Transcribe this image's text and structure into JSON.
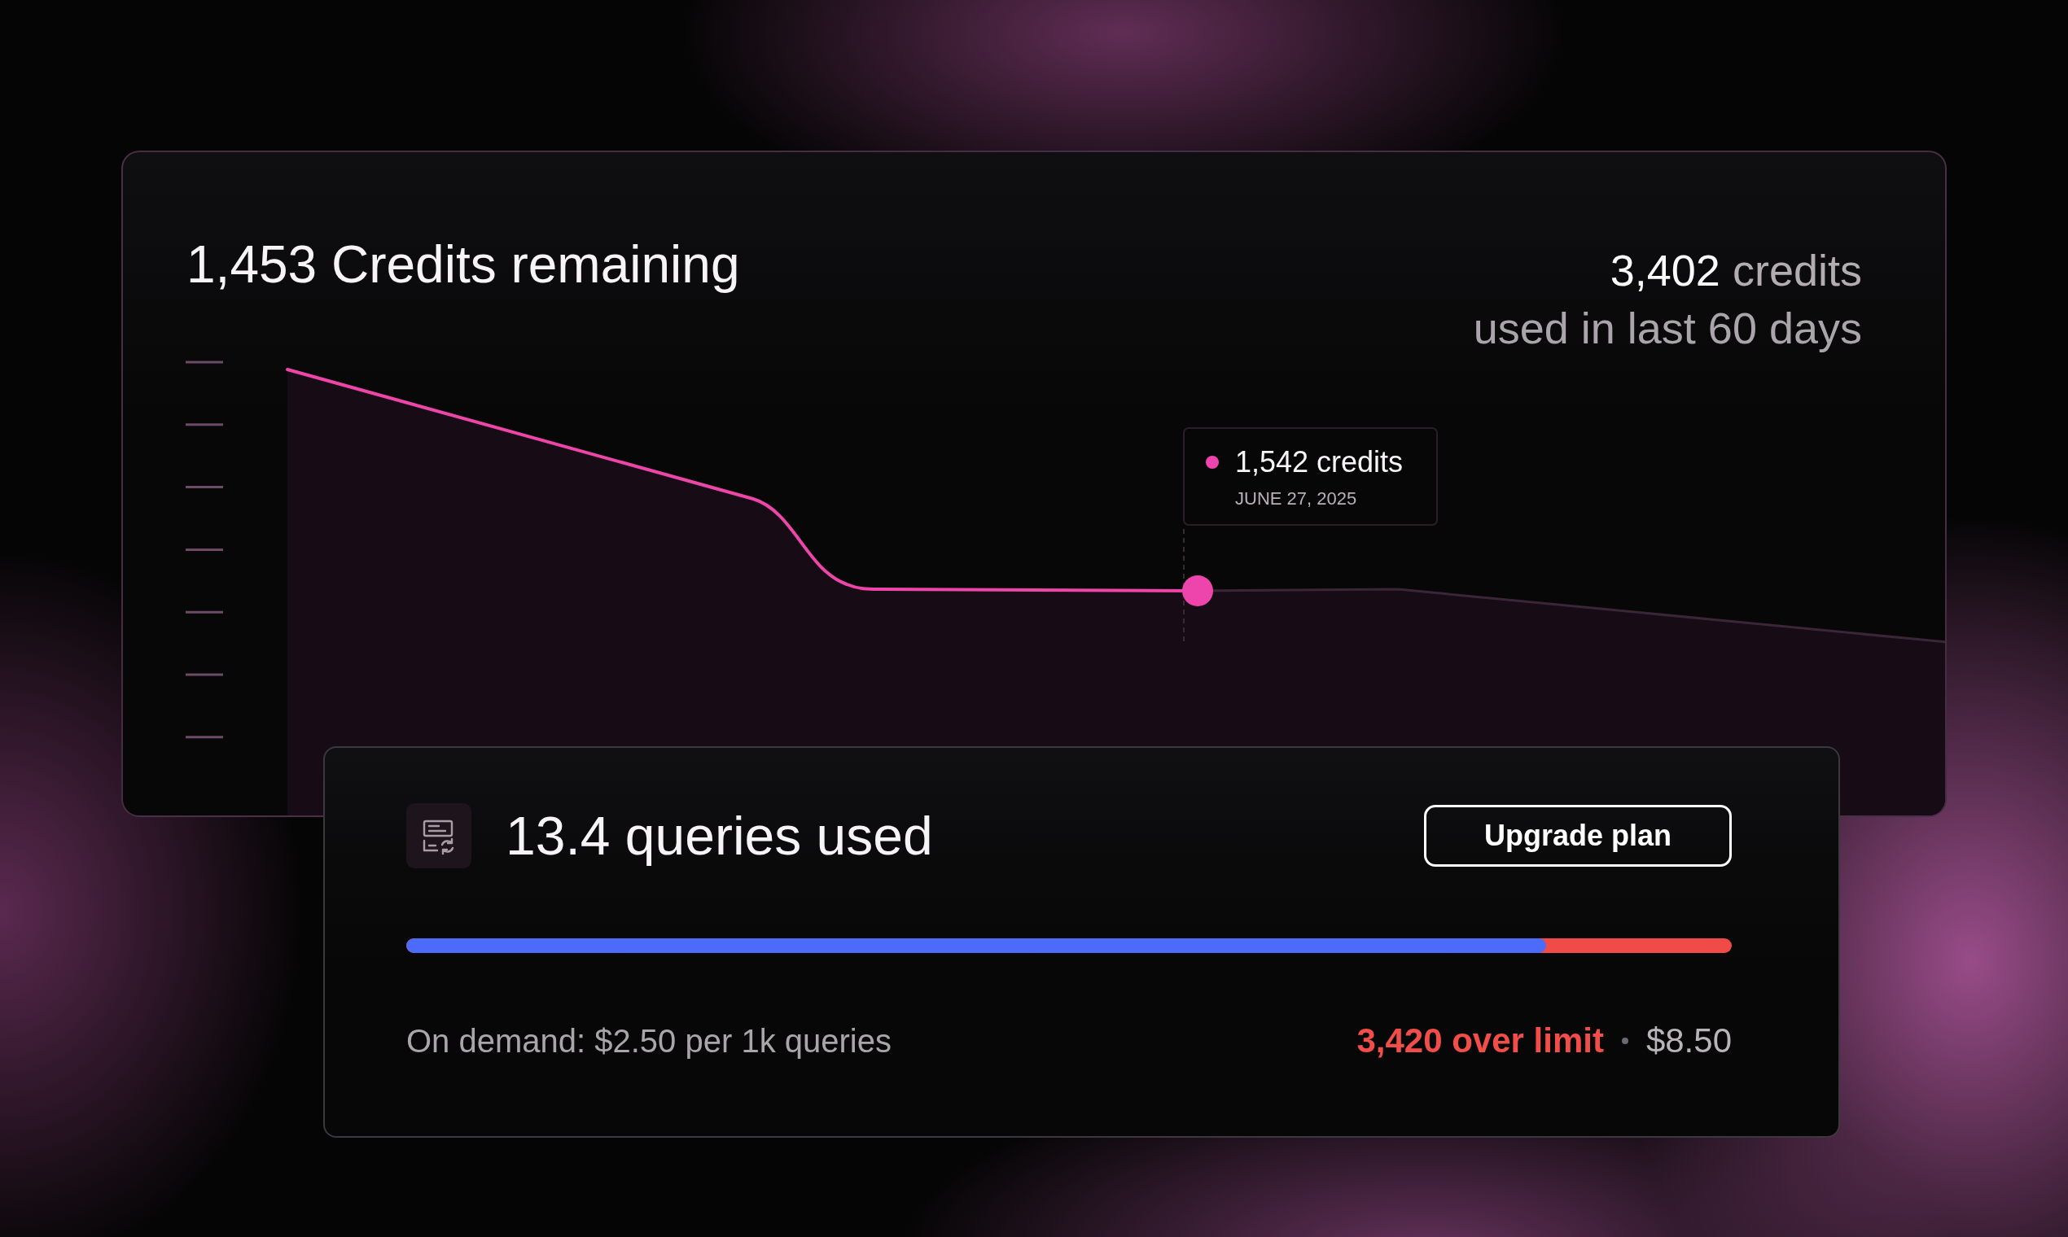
{
  "credits_card": {
    "title": "1,453 Credits remaining",
    "usage": {
      "amount": "3,402",
      "unit": "credits",
      "caption": "used in last 60 days"
    },
    "tooltip": {
      "value": "1,542 credits",
      "date": "JUNE 27, 2025"
    }
  },
  "queries_card": {
    "title": "13.4 queries used",
    "button": "Upgrade plan",
    "progress": {
      "level": 0.86
    },
    "pricing": "On demand: $2.50 per 1k queries",
    "overage": "3,420 over limit",
    "cost": "$8.50"
  }
}
